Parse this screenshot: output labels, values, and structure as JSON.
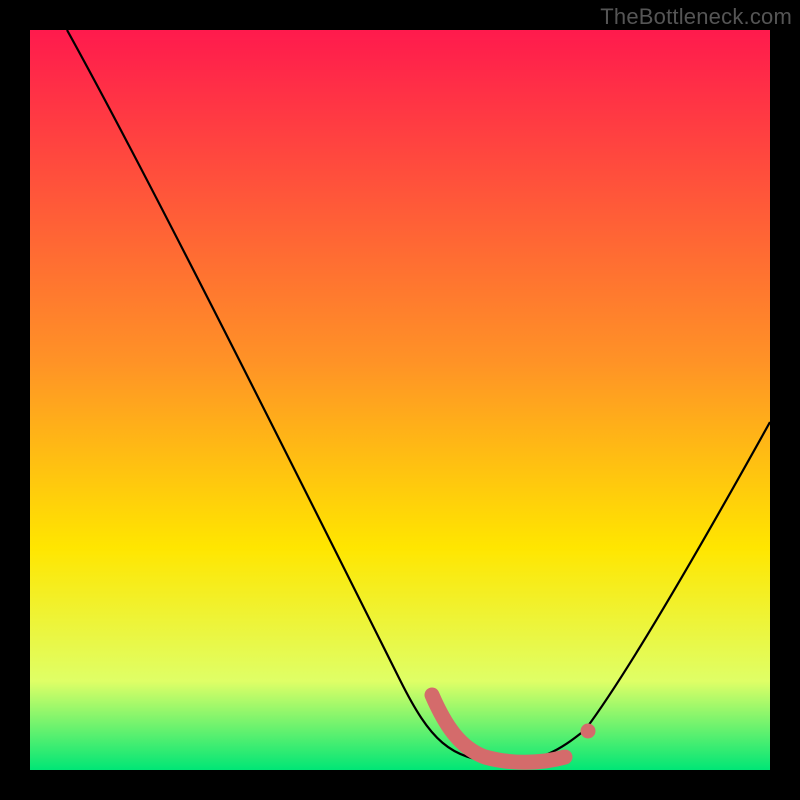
{
  "watermark": "TheBottleneck.com",
  "colors": {
    "frame": "#000000",
    "curve": "#000000",
    "marker": "#d46b6b",
    "grad_top": "#ff1a4d",
    "grad_mid1": "#ff9326",
    "grad_mid2": "#ffe600",
    "grad_bot1": "#dfff66",
    "grad_bot2": "#00e676"
  },
  "chart_data": {
    "type": "line",
    "title": "",
    "xlabel": "",
    "ylabel": "",
    "xlim": [
      0,
      100
    ],
    "ylim": [
      0,
      100
    ],
    "grid": false,
    "legend": false,
    "series": [
      {
        "name": "bottleneck-curve",
        "x": [
          5,
          10,
          15,
          20,
          25,
          30,
          35,
          40,
          45,
          50,
          55,
          58,
          60,
          62,
          65,
          68,
          70,
          72,
          75,
          80,
          85,
          90,
          95,
          100
        ],
        "y": [
          100,
          91,
          82,
          73,
          64,
          55,
          46,
          37,
          28,
          19,
          10,
          5,
          3,
          2,
          1,
          1,
          1,
          2,
          4,
          11,
          20,
          29,
          38,
          47
        ]
      }
    ],
    "markers": [
      {
        "name": "optimal-zone-left-edge",
        "x_range": [
          55,
          60
        ],
        "y_range": [
          2,
          10
        ]
      },
      {
        "name": "optimal-zone-floor",
        "x_range": [
          60,
          72
        ],
        "y_range": [
          1,
          2
        ]
      },
      {
        "name": "optimal-zone-right-dot",
        "x_range": [
          74,
          76
        ],
        "y_range": [
          3,
          5
        ]
      }
    ],
    "note": "Values estimated from pixel positions; chart has no axis ticks or labels."
  }
}
